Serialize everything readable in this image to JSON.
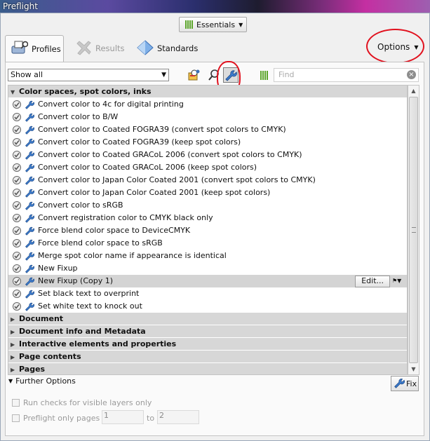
{
  "window": {
    "title": "Preflight"
  },
  "top_button": {
    "label": "Essentials",
    "icon": "bar-chart-icon",
    "color": "#5ca52b"
  },
  "tabs": [
    {
      "label": "Profiles",
      "icon": "profiles-icon",
      "state": "active"
    },
    {
      "label": "Results",
      "icon": "results-icon",
      "state": "disabled"
    },
    {
      "label": "Standards",
      "icon": "standards-icon",
      "state": "normal"
    }
  ],
  "options": {
    "label": "Options"
  },
  "toolbar": {
    "filter_value": "Show all",
    "search_placeholder": "Find",
    "icons": [
      "profiles-filter-icon",
      "checks-filter-icon",
      "fixups-filter-icon",
      "bar-chart-icon"
    ]
  },
  "tree": {
    "groups": [
      {
        "label": "Color spaces, spot colors, inks",
        "expanded": true,
        "items": [
          "Convert color to 4c for digital printing",
          "Convert color to B/W",
          "Convert color to Coated FOGRA39 (convert spot colors to CMYK)",
          "Convert color to Coated FOGRA39 (keep spot colors)",
          "Convert color to Coated GRACoL 2006 (convert spot colors to CMYK)",
          "Convert color to Coated GRACoL 2006 (keep spot colors)",
          "Convert color to Japan Color Coated 2001 (convert spot colors to CMYK)",
          "Convert color to Japan Color Coated 2001 (keep spot colors)",
          "Convert color to sRGB",
          "Convert registration color to CMYK black only",
          "Force blend color space to DeviceCMYK",
          "Force blend color space to sRGB",
          "Merge spot color name if appearance is identical",
          "New Fixup",
          "New Fixup (Copy 1)",
          "Set black text to overprint",
          "Set white text to knock out"
        ],
        "selected_index": 14
      },
      {
        "label": "Document",
        "expanded": false
      },
      {
        "label": "Document info and Metadata",
        "expanded": false
      },
      {
        "label": "Interactive elements and properties",
        "expanded": false
      },
      {
        "label": "Page contents",
        "expanded": false
      },
      {
        "label": "Pages",
        "expanded": false
      }
    ],
    "edit_label": "Edit..."
  },
  "further_options": {
    "label": "Further Options",
    "fix_label": "Fix",
    "run_checks_label": "Run checks for visible layers only",
    "preflight_pages_label": "Preflight only pages",
    "page_from": "1",
    "to_label": "to",
    "page_to": "2"
  },
  "colors": {
    "annotation": "#e1111e",
    "selection": "#d4d4d4",
    "group_header": "#d7d7d7"
  }
}
